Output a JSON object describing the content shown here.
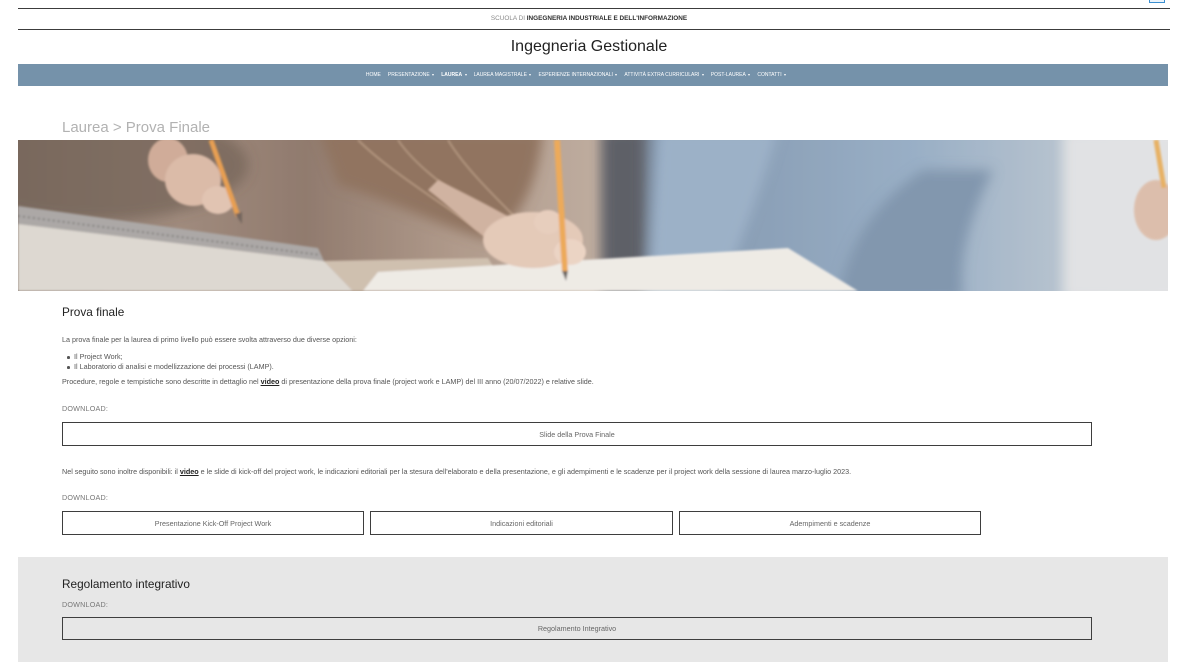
{
  "header": {
    "school_prefix": "SCUOLA DI",
    "school_name": "INGEGNERIA INDUSTRIALE E DELL'INFORMAZIONE",
    "site_title": "Ingegneria Gestionale"
  },
  "nav": {
    "dropdown_icon": "chevron-down-icon",
    "items": [
      {
        "label": "HOME",
        "has_dropdown": false,
        "active": false
      },
      {
        "label": "PRESENTAZIONE",
        "has_dropdown": true,
        "active": false
      },
      {
        "label": "LAUREA",
        "has_dropdown": true,
        "active": true
      },
      {
        "label": "LAUREA MAGISTRALE",
        "has_dropdown": true,
        "active": false
      },
      {
        "label": "ESPERIENZE INTERNAZIONALI",
        "has_dropdown": true,
        "active": false
      },
      {
        "label": "ATTIVITÀ EXTRA CURRICULARI",
        "has_dropdown": true,
        "active": false
      },
      {
        "label": "POST-LAUREA",
        "has_dropdown": true,
        "active": false
      },
      {
        "label": "CONTATTI",
        "has_dropdown": true,
        "active": false
      }
    ]
  },
  "page_heading": "Laurea > Prova Finale",
  "prova_finale": {
    "heading": "Prova finale",
    "intro": "La prova finale per la laurea di primo livello può essere svolta attraverso due diverse opzioni:",
    "options": [
      "Il Project Work;",
      "Il Laboratorio di analisi e modellizzazione dei processi (LAMP)."
    ],
    "procedure": {
      "before": "Procedure, regole e tempistiche sono descritte in dettaglio nel ",
      "link": "video",
      "after": " di presentazione della prova finale (project work e LAMP) del III anno (20/07/2022) e relative slide."
    },
    "download_label": "DOWNLOAD:",
    "download_buttons": [
      "Slide della Prova Finale"
    ],
    "more": {
      "before": "Nel seguito sono inoltre disponibili: il ",
      "link": "video",
      "after": " e le slide di kick-off del project work, le indicazioni editoriali per la stesura dell'elaborato e della presentazione, e gli adempimenti e le scadenze per il project work della sessione di laurea marzo-luglio 2023."
    },
    "download_label_2": "DOWNLOAD:",
    "download_buttons_2": [
      "Presentazione Kick-Off Project Work",
      "Indicazioni editoriali",
      "Adempimenti e scadenze"
    ]
  },
  "regolamento": {
    "heading": "Regolamento integrativo",
    "download_label": "DOWNLOAD:",
    "button": "Regolamento Integrativo"
  },
  "colors": {
    "nav_bg": "#7592aa",
    "section_bg": "#e7e7e7",
    "page_heading": "#b2b2b2",
    "corner_accent": "#3b8fd0"
  }
}
